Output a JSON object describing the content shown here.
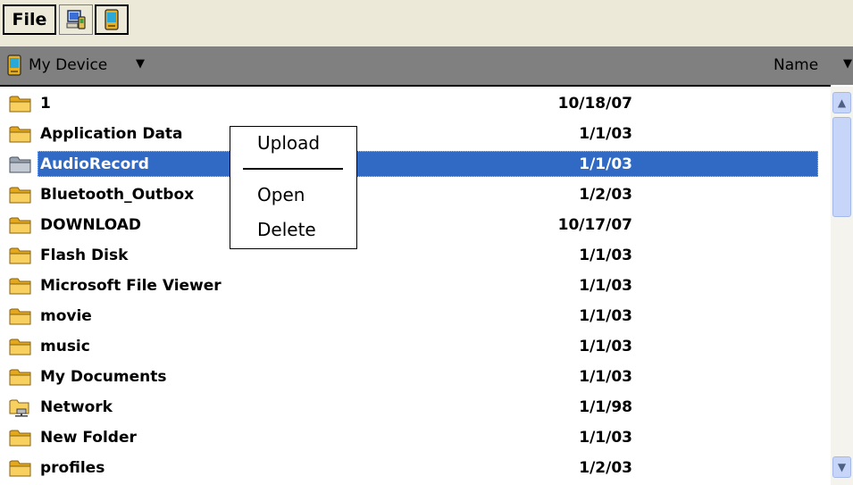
{
  "menubar": {
    "file_label": "File"
  },
  "location": {
    "label": "My Device",
    "sort_label": "Name"
  },
  "files": [
    {
      "name": "1",
      "date": "10/18/07",
      "icon": "folder-icon"
    },
    {
      "name": "Application Data",
      "date": "1/1/03",
      "icon": "folder-icon"
    },
    {
      "name": "AudioRecord",
      "date": "1/1/03",
      "icon": "folder-icon",
      "selected": true
    },
    {
      "name": "Bluetooth_Outbox",
      "date": "1/2/03",
      "icon": "folder-icon"
    },
    {
      "name": "DOWNLOAD",
      "date": "10/17/07",
      "icon": "folder-icon"
    },
    {
      "name": "Flash Disk",
      "date": "1/1/03",
      "icon": "folder-icon"
    },
    {
      "name": "Microsoft File Viewer",
      "date": "1/1/03",
      "icon": "folder-icon"
    },
    {
      "name": "movie",
      "date": "1/1/03",
      "icon": "folder-icon"
    },
    {
      "name": "music",
      "date": "1/1/03",
      "icon": "folder-icon"
    },
    {
      "name": "My Documents",
      "date": "1/1/03",
      "icon": "folder-icon"
    },
    {
      "name": "Network",
      "date": "1/1/98",
      "icon": "network-folder-icon"
    },
    {
      "name": "New Folder",
      "date": "1/1/03",
      "icon": "folder-icon"
    },
    {
      "name": "profiles",
      "date": "1/2/03",
      "icon": "folder-icon"
    }
  ],
  "context_menu": {
    "upload": "Upload",
    "open": "Open",
    "delete": "Delete"
  },
  "colors": {
    "selection": "#316ac5",
    "folder": "#f5c542",
    "header_bar": "#808080"
  }
}
